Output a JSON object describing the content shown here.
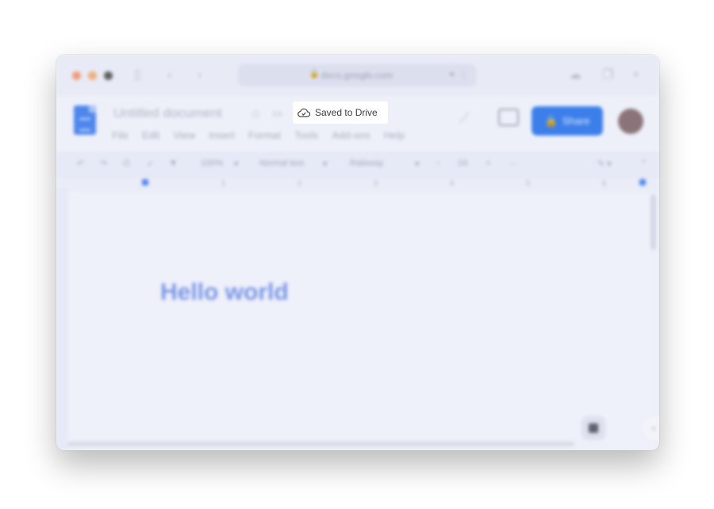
{
  "browser": {
    "address": "docs.google.com",
    "tabs_icons": [
      "sidebar-icon",
      "back-icon",
      "forward-icon",
      "cloud-icon",
      "copy-icon",
      "plus-icon"
    ]
  },
  "doc": {
    "title": "Untitled document",
    "status": "Saved to Drive",
    "menu": [
      "File",
      "Edit",
      "View",
      "Insert",
      "Format",
      "Tools",
      "Add-ons",
      "Help"
    ],
    "share_label": "Share"
  },
  "toolbar": {
    "zoom": "100%",
    "style": "Normal text",
    "font": "Raleway",
    "font_size": "24"
  },
  "ruler": {
    "numbers": [
      "1",
      "2",
      "3",
      "4",
      "5",
      "6"
    ]
  },
  "body": {
    "text": "Hello world"
  },
  "colors": {
    "accent": "#3c7fea",
    "heading_text": "#7a96e6",
    "doc_logo": "#4f86ec"
  }
}
